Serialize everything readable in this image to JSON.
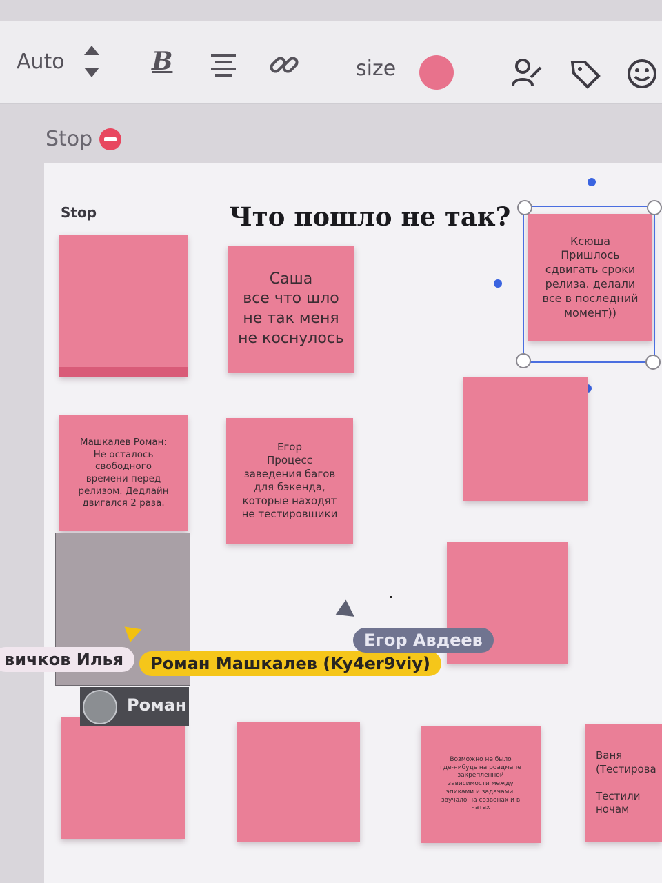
{
  "toolbar": {
    "font_size_mode": "Auto",
    "bold_label": "B",
    "size_label": "size",
    "color": "#e8728c",
    "icons": [
      "stepper-arrows-icon",
      "bold-icon",
      "align-center-icon",
      "link-icon",
      "color-swatch",
      "assign-person-icon",
      "tag-icon",
      "emoji-icon"
    ]
  },
  "frame": {
    "title": "Stop",
    "board_label": "Stop",
    "heading": "Что пошло не так?"
  },
  "stickies": {
    "sasha": "Саша\nвсе что шло\nне так меня\nне коснулось",
    "ksyusha": "Ксюша\nПришлось\nсдвигать сроки\nрелиза. делали\nвсе в последний\nмомент))",
    "mashkalev": "Машкалев Роман:\nНе осталось\nсвободного\nвремени перед\nрелизом. Дедлайн\nдвигался 2 раза.",
    "egor": "Егор\nПроцесс\nзаведения багов\nдля бэкенда,\nкоторые находят\nне тестировщики",
    "roadmap": "Возможно не было\nгде-нибудь на роадмапе\nзакрепленной\nзависимости между\nэпиками и задачами.\nзвучало на созвонах и в\nчатах",
    "vanya": "Ваня\n(Тестирова\n\nТестили\nночам"
  },
  "users": {
    "ilya": "вичков Илья",
    "roman_full": "Роман Машкалев (Ky4er9viy)",
    "egor_full": "Егор Авдеев",
    "roman_short": "Роман"
  },
  "colors": {
    "sticky": "#ea7f97",
    "selection": "#4a6ee0",
    "cursor_yellow": "#f2c10f"
  }
}
